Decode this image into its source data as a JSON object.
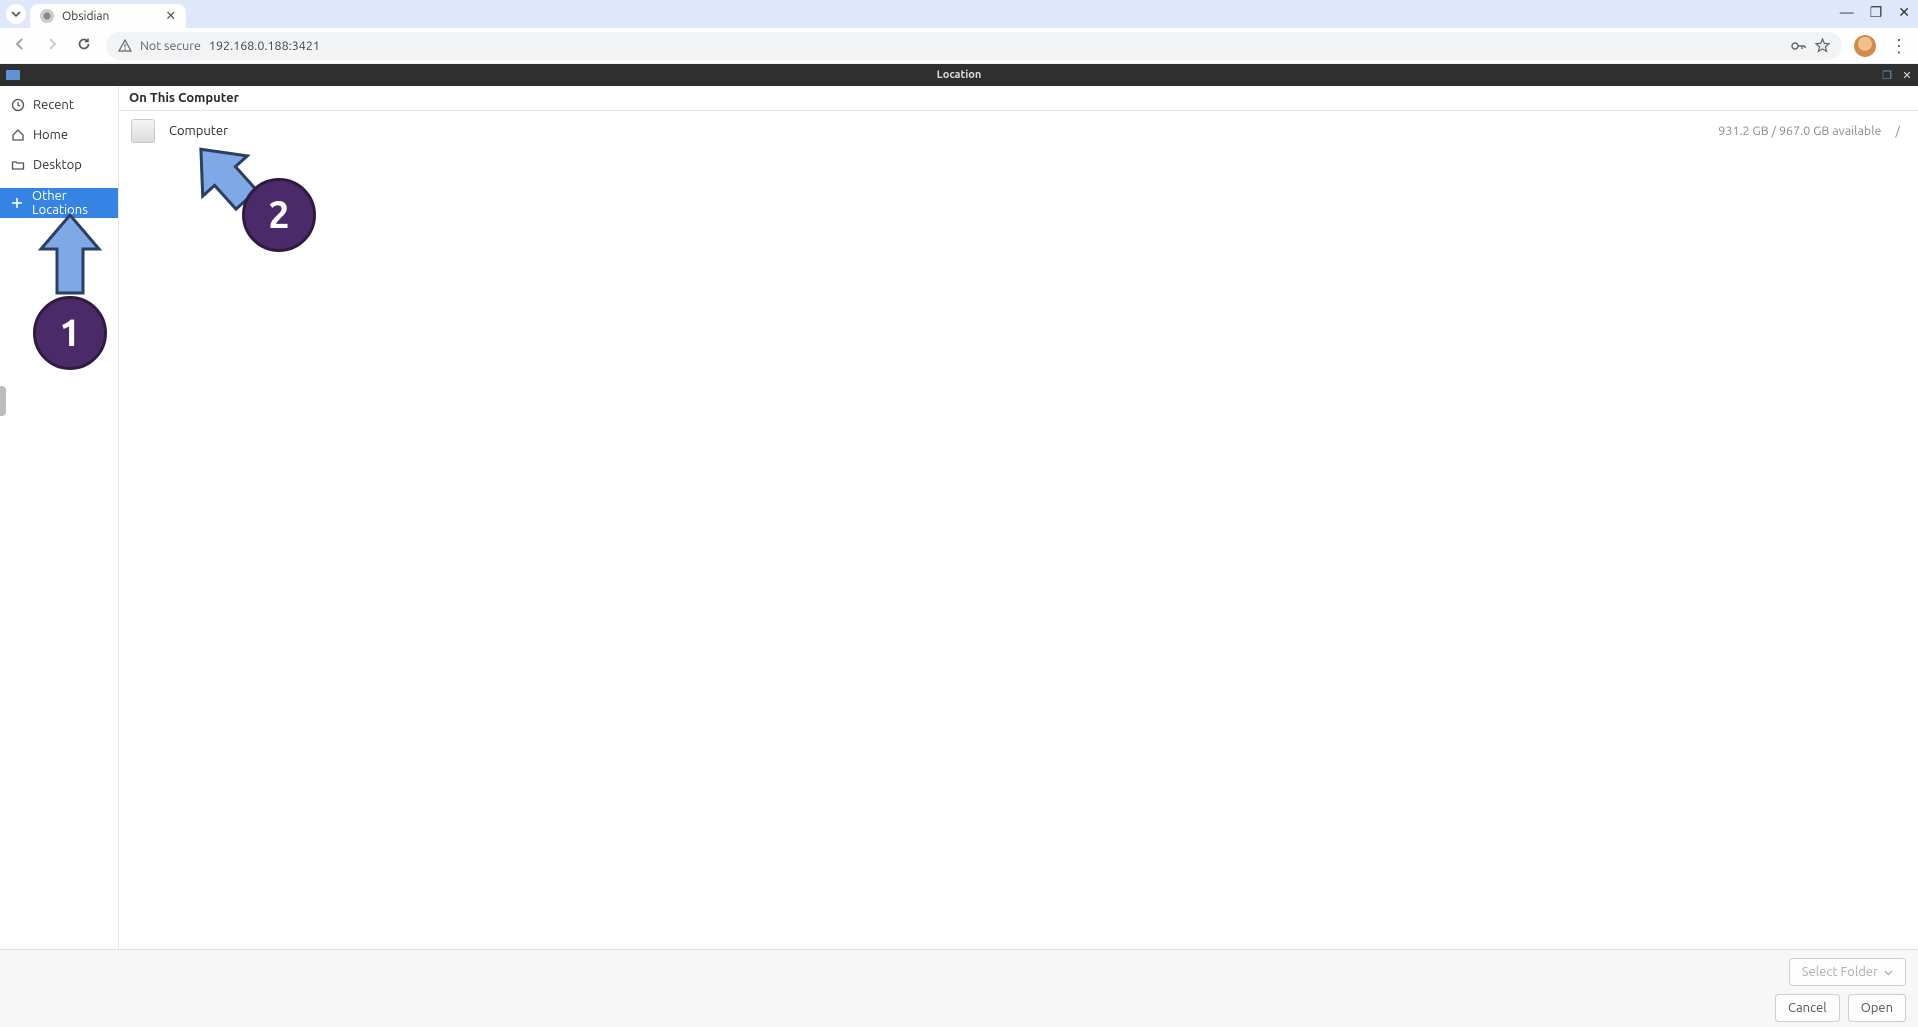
{
  "browser": {
    "tab_title": "Obsidian",
    "not_secure_label": "Not secure",
    "url": "192.168.0.188:3421"
  },
  "app": {
    "title": "Location",
    "sidebar": {
      "items": [
        {
          "label": "Recent"
        },
        {
          "label": "Home"
        },
        {
          "label": "Desktop"
        },
        {
          "label": "Other Locations"
        }
      ]
    },
    "main": {
      "header": "On This Computer",
      "device": {
        "name": "Computer",
        "size": "931.2 GB / 967.0 GB available",
        "mount": "/"
      }
    },
    "footer": {
      "select_folder_label": "Select Folder",
      "cancel_label": "Cancel",
      "open_label": "Open"
    }
  },
  "annotations": {
    "one": "1",
    "two": "2"
  }
}
